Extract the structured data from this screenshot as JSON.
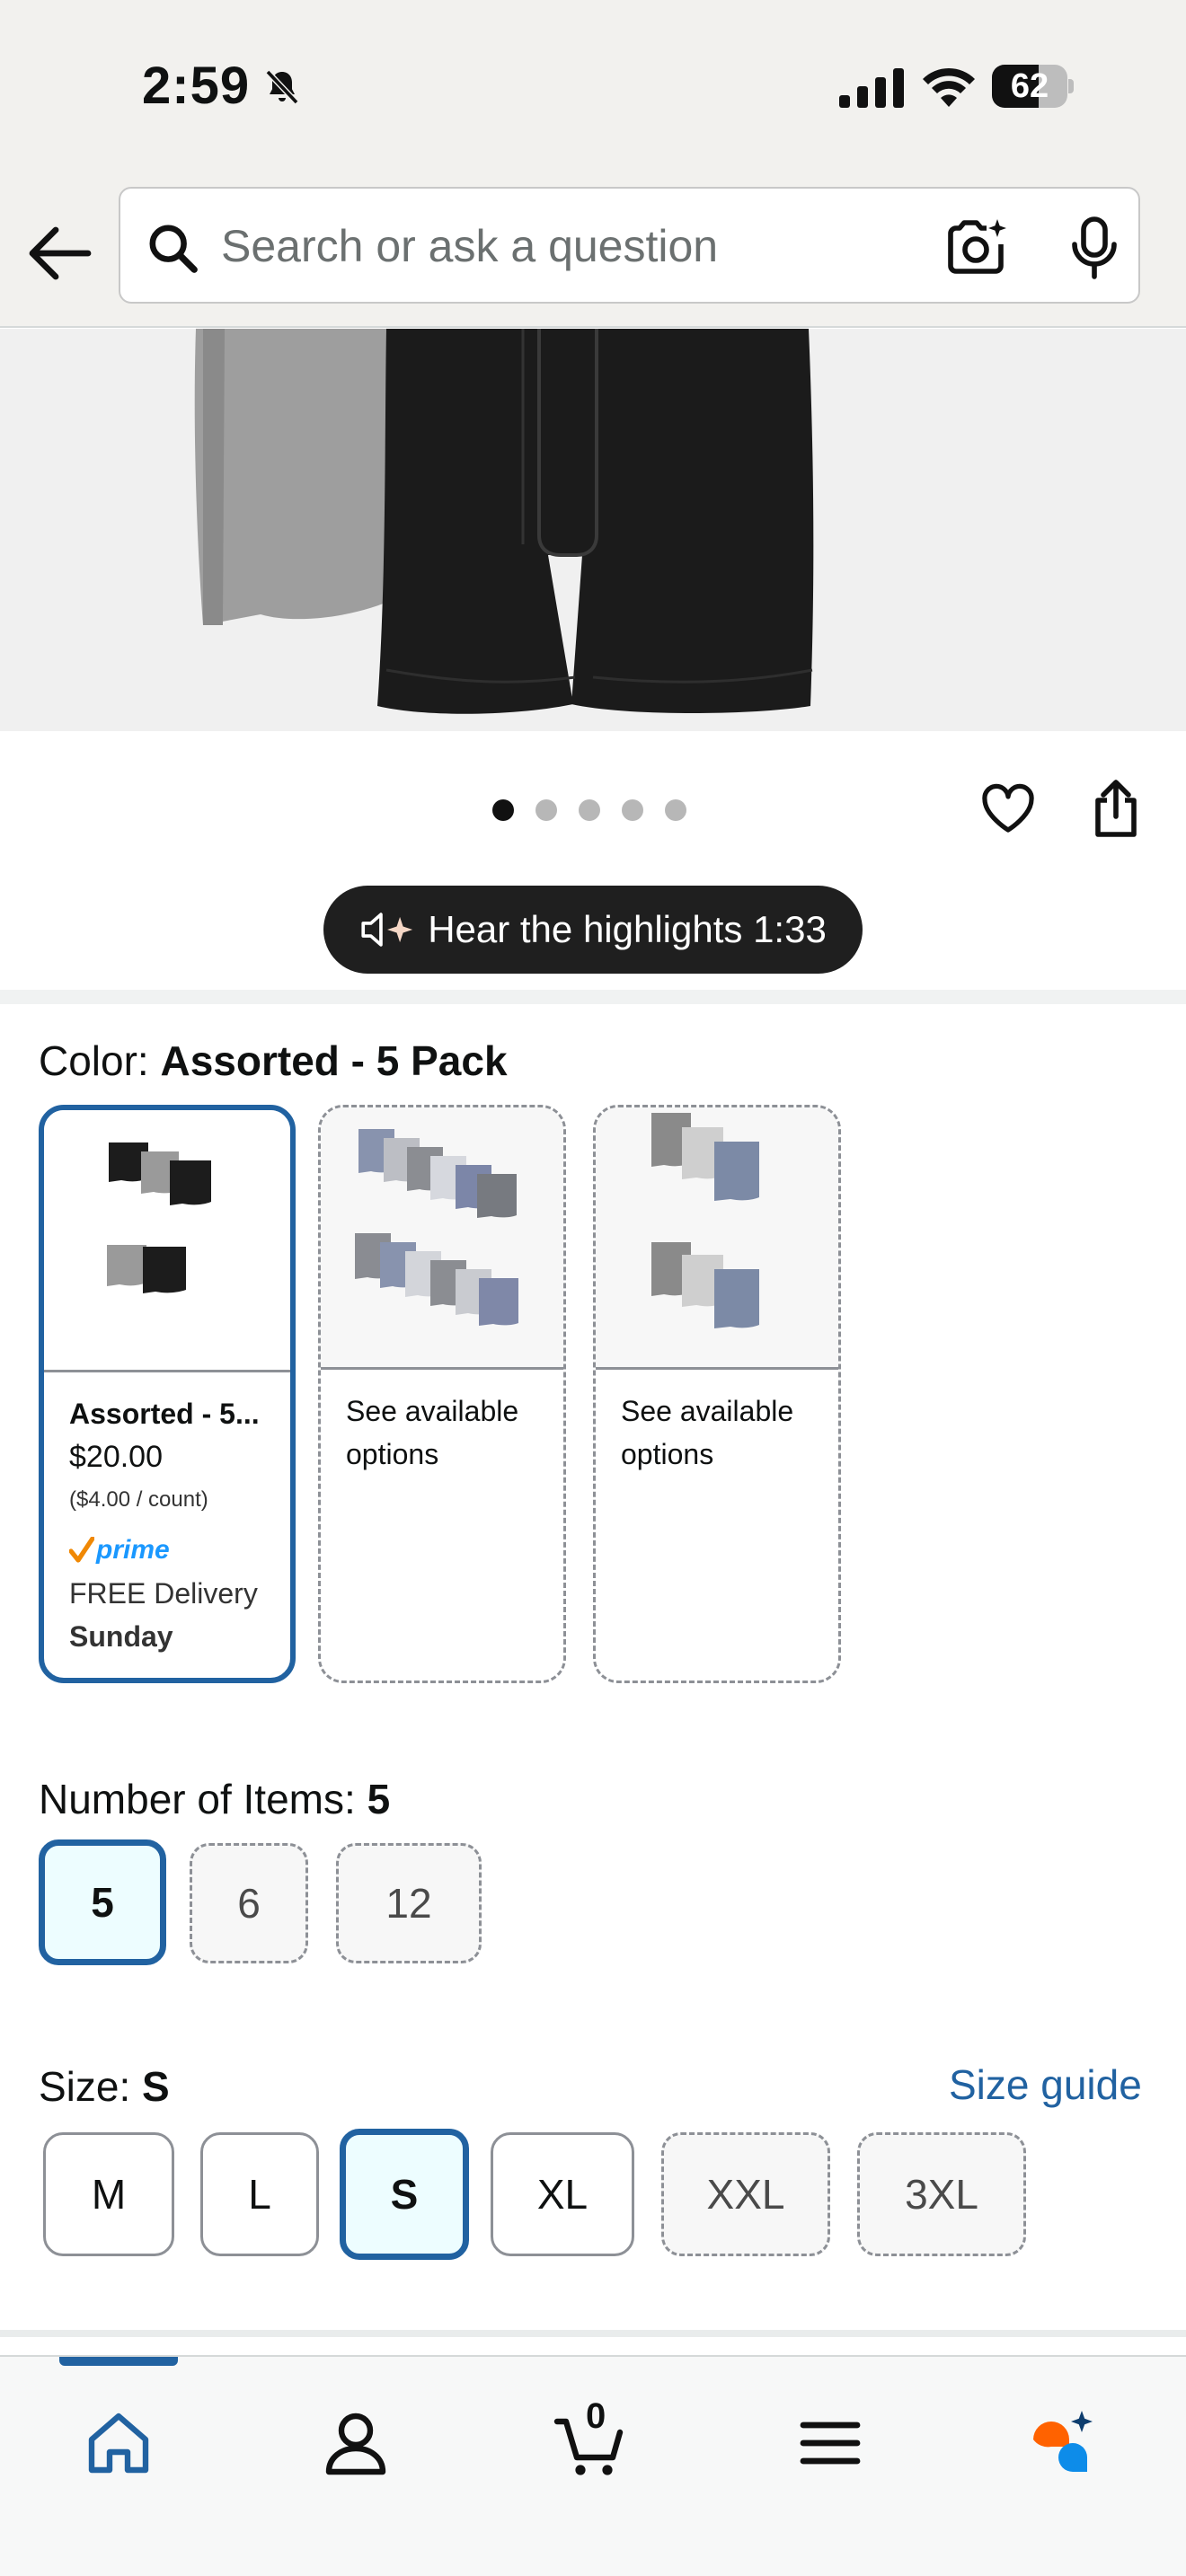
{
  "status_bar": {
    "time": "2:59",
    "battery": "62",
    "battery_level": 0.62
  },
  "search": {
    "placeholder": "Search or ask a question"
  },
  "carousel": {
    "dot_count": 5,
    "active_index": 0
  },
  "audio": {
    "label": "Hear the highlights 1:33"
  },
  "color": {
    "label_prefix": "Color: ",
    "selected": "Assorted - 5 Pack",
    "options": [
      {
        "name": "Assorted - 5...",
        "price": "$20.00",
        "unit": "($4.00 / count)",
        "badge": "prime",
        "delivery": "FREE Delivery",
        "day": "Sunday"
      },
      {
        "text": "See available options"
      },
      {
        "text": "See available options"
      }
    ]
  },
  "items": {
    "label_prefix": "Number of Items: ",
    "selected": "5",
    "options": [
      "5",
      "6",
      "12"
    ]
  },
  "size": {
    "label_prefix": "Size: ",
    "selected": "S",
    "guide": "Size guide",
    "options": [
      "M",
      "L",
      "S",
      "XL",
      "XXL",
      "3XL"
    ]
  },
  "nav": {
    "cart_count": "0"
  },
  "colors": {
    "link_blue": "#2162a1",
    "prime_blue": "#1a98ff",
    "prime_check": "#f08804",
    "rufus_orange": "#ff6200",
    "rufus_blue": "#0d8ce9"
  }
}
